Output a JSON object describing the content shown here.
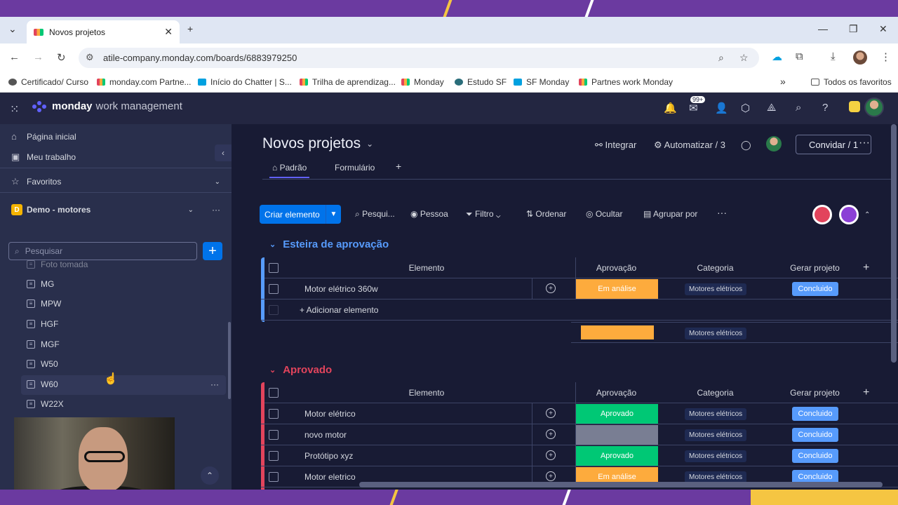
{
  "browser": {
    "tab_title": "Novos projetos",
    "url": "atile-company.monday.com/boards/6883979250",
    "bookmarks": [
      {
        "label": "Certificado/ Curso",
        "color": "#555555"
      },
      {
        "label": "monday.com Partne...",
        "color": "#e2445c"
      },
      {
        "label": "Início do Chatter | S...",
        "color": "#00a1e0"
      },
      {
        "label": "Trilha de aprendizag...",
        "color": "#e2445c"
      },
      {
        "label": "Monday",
        "color": "#e2445c"
      },
      {
        "label": "Estudo SF",
        "color": "#2a6d7a"
      },
      {
        "label": "SF Monday",
        "color": "#00a1e0"
      },
      {
        "label": "Partnes work Monday",
        "color": "#e2445c"
      }
    ],
    "all_favorites": "Todos os favoritos",
    "notification_count": "99+"
  },
  "app": {
    "brand": "monday",
    "product": "work management"
  },
  "sidebar": {
    "home": "Página inicial",
    "my_work": "Meu trabalho",
    "favorites": "Favoritos",
    "workspace_letter": "D",
    "workspace": "Demo - motores",
    "search_placeholder": "Pesquisar",
    "boards": [
      "Foto tomada",
      "MG",
      "MPW",
      "HGF",
      "MGF",
      "W50",
      "W60",
      "W22X"
    ]
  },
  "board": {
    "title": "Novos projetos",
    "actions": {
      "integrate": "Integrar",
      "automate": "Automatizar / 3",
      "invite": "Convidar / 1"
    },
    "views": [
      "Padrão",
      "Formulário"
    ],
    "toolbar": {
      "create": "Criar elemento",
      "search": "Pesqui...",
      "person": "Pessoa",
      "filter": "Filtro",
      "sort": "Ordenar",
      "hide": "Ocultar",
      "group_by": "Agrupar por"
    },
    "columns": [
      "Elemento",
      "Aprovação",
      "Categoria",
      "Gerar projeto"
    ],
    "groups": [
      {
        "title": "Esteira de aprovação",
        "color": "#579bfc",
        "rows": [
          {
            "name": "Motor elétrico 360w",
            "status": "Em análise",
            "status_color": "#fdab3d",
            "category": "Motores elétricos",
            "action": "Concluido"
          }
        ],
        "add_item": "+ Adicionar elemento",
        "summary_category": "Motores elétricos"
      },
      {
        "title": "Aprovado",
        "color": "#e2445c",
        "rows": [
          {
            "name": "Motor elétrico",
            "status": "Aprovado",
            "status_color": "#00c875",
            "category": "Motores elétricos",
            "action": "Concluido"
          },
          {
            "name": "novo motor",
            "status": "",
            "status_color": "#797e93",
            "category": "Motores elétricos",
            "action": "Concluido"
          },
          {
            "name": "Protótipo xyz",
            "status": "Aprovado",
            "status_color": "#00c875",
            "category": "Motores elétricos",
            "action": "Concluido"
          },
          {
            "name": "Motor eletrico",
            "status": "Em análise",
            "status_color": "#fdab3d",
            "category": "Motores elétricos",
            "action": "Concluido"
          }
        ]
      }
    ]
  }
}
